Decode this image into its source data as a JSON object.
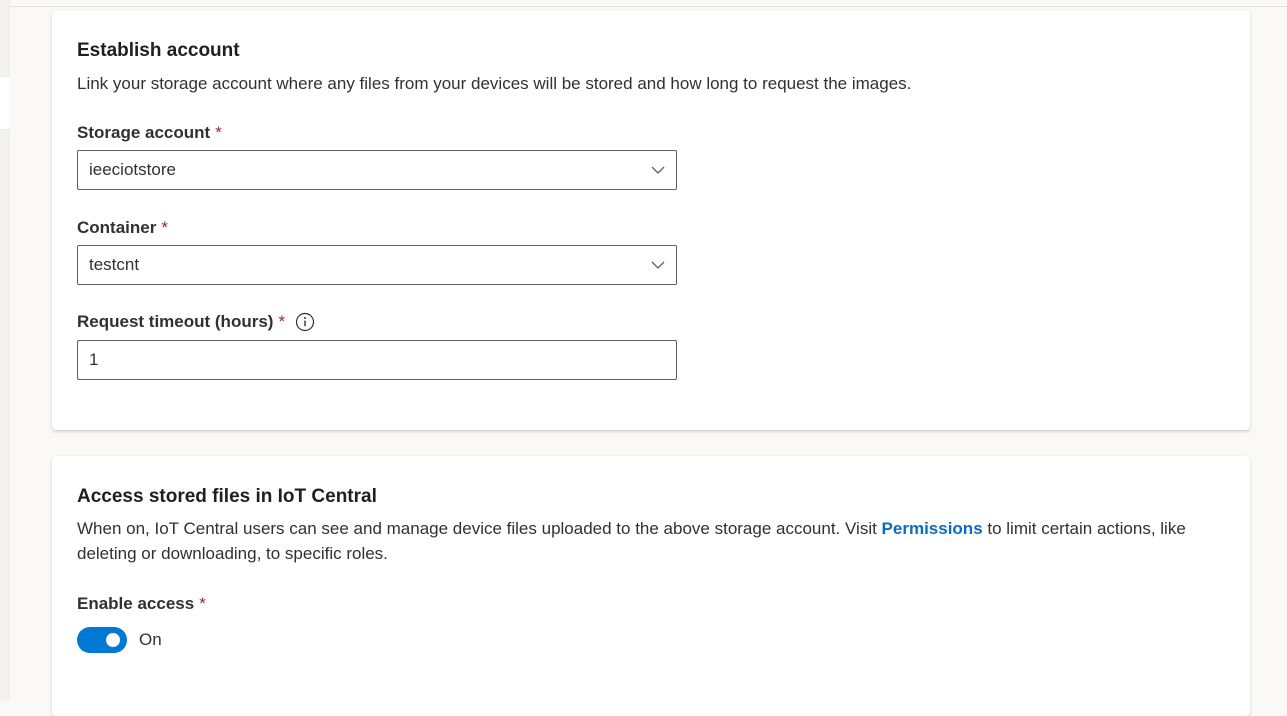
{
  "establish": {
    "title": "Establish account",
    "description": "Link your storage account where any files from your devices will be stored and how long to request the images.",
    "storage_label": "Storage account",
    "storage_value": "ieeciotstore",
    "container_label": "Container",
    "container_value": "testcnt",
    "timeout_label": "Request timeout (hours)",
    "timeout_value": "1",
    "required_marker": "*"
  },
  "access": {
    "title": "Access stored files in IoT Central",
    "description_before": "When on, IoT Central users can see and manage device files uploaded to the above storage account. Visit ",
    "permissions_link": "Permissions",
    "description_after": " to limit certain actions, like deleting or downloading, to specific roles.",
    "enable_label": "Enable access",
    "required_marker": "*",
    "toggle_state": "On"
  },
  "icons": {
    "dropdown": "chevron-down-icon",
    "info": "info-icon"
  },
  "colors": {
    "accent": "#0078d4",
    "link": "#0f6cbd",
    "required": "#a4262c"
  }
}
